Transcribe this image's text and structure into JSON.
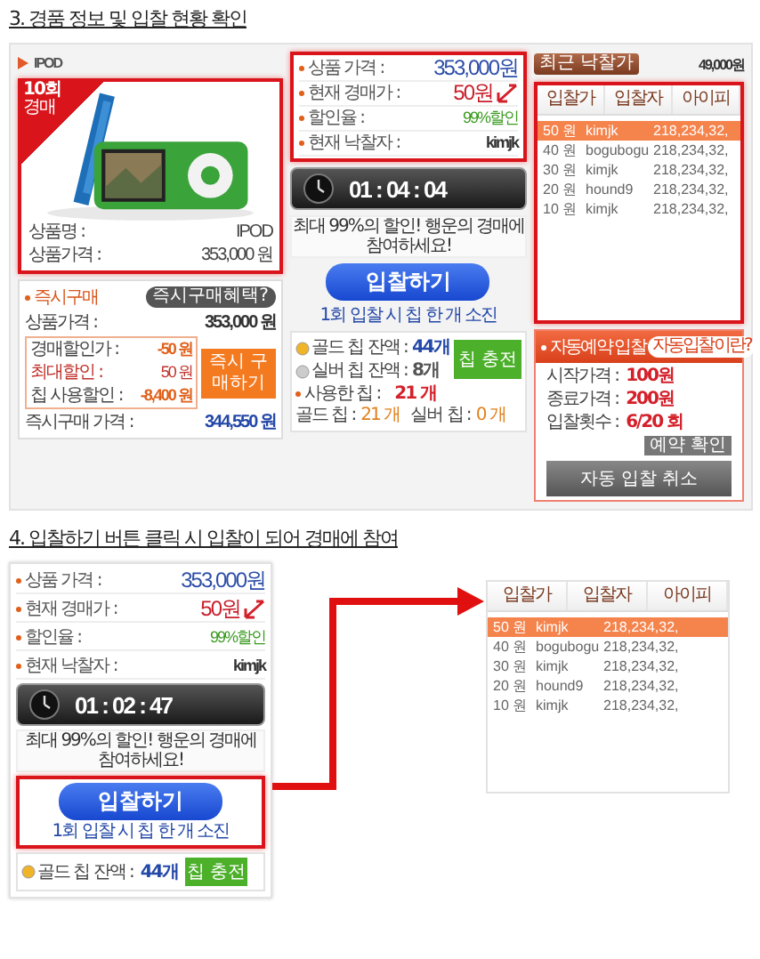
{
  "step3": {
    "heading": "3. 경품 정보 및 입찰 현황 확인",
    "product": {
      "title": "IPOD",
      "badge_count": "10회",
      "badge_label": "경매",
      "fields": [
        {
          "label": "상품명 :",
          "value": "IPOD"
        },
        {
          "label": "상품가격 :",
          "value": "353,000 원"
        }
      ]
    },
    "instant_buy": {
      "title": "즉시구매",
      "help_button": "즉시구매혜택?",
      "price": {
        "label": "상품가격 :",
        "value": "353,000 원"
      },
      "discounts": [
        {
          "label": "경매할인가 :",
          "value": "-50 원",
          "kind": "discount"
        },
        {
          "label": "최대할인 :",
          "value": "50 원",
          "kind": "limit"
        },
        {
          "label": "칩 사용할인 :",
          "value": "-8,400 원",
          "kind": "discount"
        }
      ],
      "buy_button": "즉시 구매하기",
      "final": {
        "label": "즉시구매 가격 :",
        "value": "344,550 원"
      }
    },
    "auction": {
      "rows": [
        {
          "label": "상품 가격 :",
          "value": "353,000원",
          "kind": "price"
        },
        {
          "label": "현재 경매가 :",
          "value": "50원",
          "kind": "bid"
        },
        {
          "label": "할인율 :",
          "value": "99%할인",
          "kind": "rate"
        },
        {
          "label": "현재 낙찰자 :",
          "value": "kimjk",
          "kind": "winner"
        }
      ],
      "timer": "01 : 04 : 04",
      "caption": "최대 99%의 할인! 행운의 경매에 참여하세요!",
      "bid_button": "입찰하기",
      "bid_note": "1회 입찰 시 칩 한 개 소진",
      "chips": {
        "balances": [
          {
            "label": "골드 칩 잔액 :",
            "value": "44개",
            "kind": "gold"
          },
          {
            "label": "실버 칩 잔액 :",
            "value": "8개",
            "kind": "silver"
          }
        ],
        "charge_button": "칩 충전",
        "used": {
          "label": "사용한 칩 :",
          "value": "21 개"
        },
        "breakdown": [
          {
            "label": "골드 칩 :",
            "value": "21 개"
          },
          {
            "label": "실버 칩 :",
            "value": "0 개"
          }
        ]
      }
    },
    "last_price": {
      "button": "최근 낙찰가",
      "value": "49,000원"
    },
    "bids": {
      "columns": [
        "입찰가",
        "입찰자",
        "아이피"
      ],
      "rows": [
        {
          "price": "50 원",
          "bidder": "kimjk",
          "ip": "218,234,32,",
          "selected": true
        },
        {
          "price": "40 원",
          "bidder": "bogubogu",
          "ip": "218,234,32,",
          "selected": false
        },
        {
          "price": "30 원",
          "bidder": "kimjk",
          "ip": "218,234,32,",
          "selected": false
        },
        {
          "price": "20 원",
          "bidder": "hound9",
          "ip": "218,234,32,",
          "selected": false
        },
        {
          "price": "10 원",
          "bidder": "kimjk",
          "ip": "218,234,32,",
          "selected": false
        }
      ]
    },
    "auto_bid": {
      "title": "자동예약 입찰",
      "help_button": "자동입찰이란?",
      "rows": [
        {
          "label": "시작가격 :",
          "value": "100원"
        },
        {
          "label": "종료가격 :",
          "value": "200원"
        },
        {
          "label": "입찰횟수 :",
          "value": "6/20 회"
        }
      ],
      "status": "예약 확인",
      "cancel_button": "자동 입찰 취소"
    }
  },
  "step4": {
    "heading": "4. 입찰하기 버튼 클릭 시 입찰이 되어 경매에 참여",
    "auction": {
      "rows": [
        {
          "label": "상품 가격 :",
          "value": "353,000원",
          "kind": "price"
        },
        {
          "label": "현재 경매가 :",
          "value": "50원",
          "kind": "bid"
        },
        {
          "label": "할인율 :",
          "value": "99%할인",
          "kind": "rate"
        },
        {
          "label": "현재 낙찰자 :",
          "value": "kimjk",
          "kind": "winner"
        }
      ],
      "timer": "01 : 02 : 47",
      "caption": "최대 99%의 할인! 행운의 경매에 참여하세요!",
      "bid_button": "입찰하기",
      "bid_note": "1회 입찰 시 칩 한 개 소진",
      "chip": {
        "label": "골드 칩 잔액 :",
        "value": "44개",
        "charge_button": "칩 충전"
      }
    },
    "bids": {
      "columns": [
        "입찰가",
        "입찰자",
        "아이피"
      ],
      "rows": [
        {
          "price": "50 원",
          "bidder": "kimjk",
          "ip": "218,234,32,",
          "selected": true
        },
        {
          "price": "40 원",
          "bidder": "bogubogu",
          "ip": "218,234,32,",
          "selected": false
        },
        {
          "price": "30 원",
          "bidder": "kimjk",
          "ip": "218,234,32,",
          "selected": false
        },
        {
          "price": "20 원",
          "bidder": "hound9",
          "ip": "218,234,32,",
          "selected": false
        },
        {
          "price": "10 원",
          "bidder": "kimjk",
          "ip": "218,234,32,",
          "selected": false
        }
      ]
    }
  }
}
